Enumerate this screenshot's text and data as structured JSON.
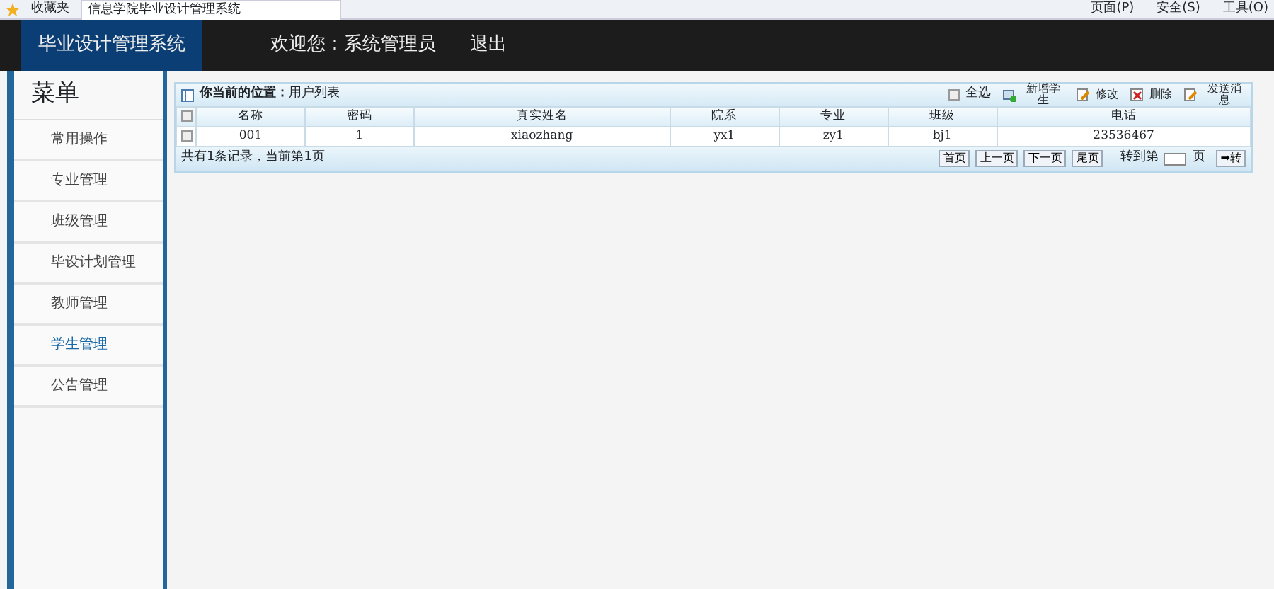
{
  "browser": {
    "favorites": "收藏夹",
    "tab_title": "信息学院毕业设计管理系统",
    "toolbar": [
      "页面(P)",
      "安全(S)",
      "工具(O)"
    ]
  },
  "header": {
    "brand": "毕业设计管理系统",
    "welcome": "欢迎您：系统管理员",
    "logout": "退出"
  },
  "sidebar": {
    "title": "菜单",
    "items": [
      {
        "label": "常用操作",
        "selected": false
      },
      {
        "label": "专业管理",
        "selected": false
      },
      {
        "label": "班级管理",
        "selected": false
      },
      {
        "label": "毕设计划管理",
        "selected": false
      },
      {
        "label": "教师管理",
        "selected": false
      },
      {
        "label": "学生管理",
        "selected": true
      },
      {
        "label": "公告管理",
        "selected": false
      }
    ]
  },
  "panel": {
    "location_label": "你当前的位置：",
    "location": "用户列表",
    "actions": [
      {
        "kind": "checkbox",
        "label": "全选",
        "checked": false
      },
      {
        "kind": "add",
        "label": "新增学生"
      },
      {
        "kind": "edit",
        "label": "修改"
      },
      {
        "kind": "delete",
        "label": "删除"
      },
      {
        "kind": "edit",
        "label": "发送消息"
      }
    ],
    "table": {
      "header_checked": false,
      "columns": [
        "名称",
        "密码",
        "真实姓名",
        "院系",
        "专业",
        "班级",
        "电话"
      ],
      "rows": [
        {
          "checked": false,
          "cells": [
            "001",
            "1",
            "xiaozhang",
            "yx1",
            "zy1",
            "bj1",
            "23536467"
          ]
        }
      ]
    },
    "footer": {
      "summary": "共有1条记录，当前第1页",
      "pager": [
        "首页",
        "上一页",
        "下一页",
        "尾页"
      ],
      "goto_label": "转到第",
      "page_unit": "页",
      "go": "➡转"
    }
  }
}
